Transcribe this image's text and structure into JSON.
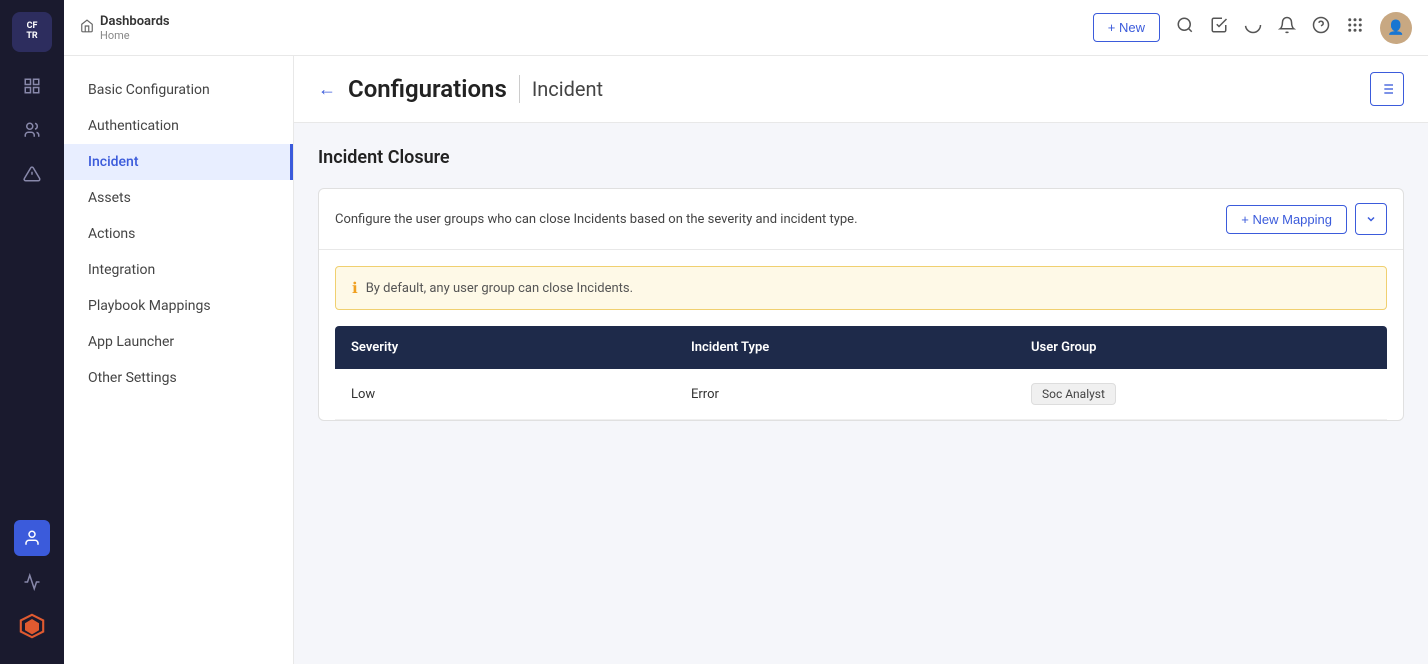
{
  "app": {
    "name": "CFTR",
    "logo_line1": "CF",
    "logo_line2": "TR"
  },
  "topnav": {
    "new_button": "+ New",
    "breadcrumb_title": "Dashboards",
    "breadcrumb_sub": "Home"
  },
  "sidebar": {
    "items": [
      {
        "id": "grid",
        "label": "Grid"
      },
      {
        "id": "users",
        "label": "Users"
      },
      {
        "id": "warning",
        "label": "Warning"
      },
      {
        "id": "person",
        "label": "Person",
        "active": true
      },
      {
        "id": "monitor",
        "label": "Monitor"
      }
    ]
  },
  "sec_sidebar": {
    "items": [
      {
        "id": "basic-config",
        "label": "Basic Configuration"
      },
      {
        "id": "authentication",
        "label": "Authentication"
      },
      {
        "id": "incident",
        "label": "Incident",
        "active": true
      },
      {
        "id": "assets",
        "label": "Assets"
      },
      {
        "id": "actions",
        "label": "Actions"
      },
      {
        "id": "integration",
        "label": "Integration"
      },
      {
        "id": "playbook-mappings",
        "label": "Playbook Mappings"
      },
      {
        "id": "app-launcher",
        "label": "App Launcher"
      },
      {
        "id": "other-settings",
        "label": "Other Settings"
      }
    ]
  },
  "page": {
    "back_label": "←",
    "title": "Configurations",
    "section": "Incident",
    "list_view_icon": "≡"
  },
  "incident_closure": {
    "section_title": "Incident Closure",
    "description": "Configure the user groups who can close Incidents based on the severity and incident type.",
    "new_mapping_btn": "+ New Mapping",
    "dropdown_icon": "⌄",
    "info_message": "By default, any user group can close Incidents.",
    "table": {
      "columns": [
        "Severity",
        "Incident Type",
        "User Group"
      ],
      "rows": [
        {
          "severity": "Low",
          "incident_type": "Error",
          "user_group": "Soc Analyst"
        }
      ]
    }
  }
}
